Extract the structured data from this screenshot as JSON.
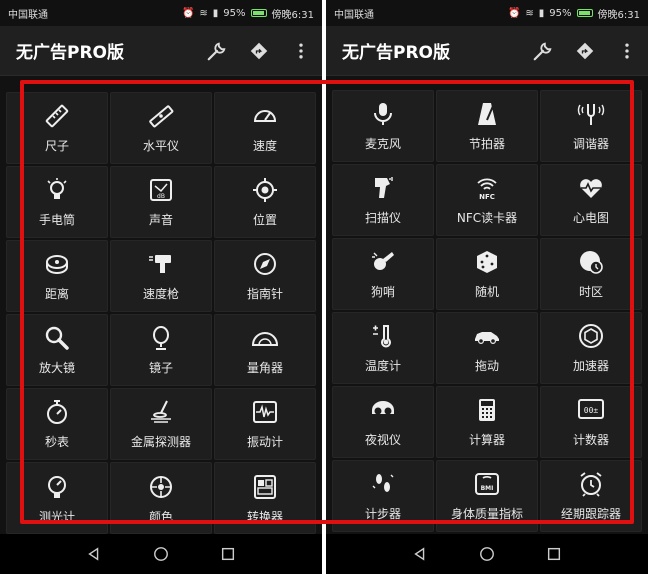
{
  "status": {
    "carrier": "中国联通",
    "battery_pct": "95%",
    "time": "傍晚6:31"
  },
  "app": {
    "title": "无广告PRO版"
  },
  "left_tools": [
    {
      "label": "尺子",
      "icon": "ruler-icon"
    },
    {
      "label": "水平仪",
      "icon": "level-icon"
    },
    {
      "label": "速度",
      "icon": "speedometer-icon"
    },
    {
      "label": "手电筒",
      "icon": "flashlight-icon"
    },
    {
      "label": "声音",
      "icon": "sound-meter-icon"
    },
    {
      "label": "位置",
      "icon": "location-icon"
    },
    {
      "label": "距离",
      "icon": "tape-measure-icon"
    },
    {
      "label": "速度枪",
      "icon": "speed-gun-icon"
    },
    {
      "label": "指南针",
      "icon": "compass-icon"
    },
    {
      "label": "放大镜",
      "icon": "magnifier-icon"
    },
    {
      "label": "镜子",
      "icon": "mirror-icon"
    },
    {
      "label": "量角器",
      "icon": "protractor-icon"
    },
    {
      "label": "秒表",
      "icon": "stopwatch-icon"
    },
    {
      "label": "金属探测器",
      "icon": "metal-detector-icon"
    },
    {
      "label": "振动计",
      "icon": "vibration-meter-icon"
    },
    {
      "label": "测光计",
      "icon": "light-meter-icon"
    },
    {
      "label": "颜色",
      "icon": "color-icon"
    },
    {
      "label": "转换器",
      "icon": "converter-icon"
    }
  ],
  "right_tools": [
    {
      "label": "麦克风",
      "icon": "microphone-icon"
    },
    {
      "label": "节拍器",
      "icon": "metronome-icon"
    },
    {
      "label": "调谐器",
      "icon": "tuning-fork-icon"
    },
    {
      "label": "扫描仪",
      "icon": "barcode-scanner-icon"
    },
    {
      "label": "NFC读卡器",
      "icon": "nfc-icon"
    },
    {
      "label": "心电图",
      "icon": "heart-rate-icon"
    },
    {
      "label": "狗哨",
      "icon": "whistle-icon"
    },
    {
      "label": "随机",
      "icon": "dice-icon"
    },
    {
      "label": "时区",
      "icon": "timezone-icon"
    },
    {
      "label": "温度计",
      "icon": "thermometer-icon"
    },
    {
      "label": "拖动",
      "icon": "car-icon"
    },
    {
      "label": "加速器",
      "icon": "accelerometer-icon"
    },
    {
      "label": "夜视仪",
      "icon": "night-vision-icon"
    },
    {
      "label": "计算器",
      "icon": "calculator-icon"
    },
    {
      "label": "计数器",
      "icon": "counter-icon"
    },
    {
      "label": "计步器",
      "icon": "footsteps-icon"
    },
    {
      "label": "身体质量指标",
      "icon": "bmi-scale-icon"
    },
    {
      "label": "经期跟踪器",
      "icon": "alarm-clock-icon"
    }
  ],
  "counter_display": "00±",
  "bmi_text": "BMI",
  "nfc_text": "NFC",
  "sound_text": "dB",
  "colors": {
    "highlight": "#e01010",
    "tile_bg": "#1e1e1e",
    "screen_bg": "#121212",
    "battery": "#7be16a"
  }
}
